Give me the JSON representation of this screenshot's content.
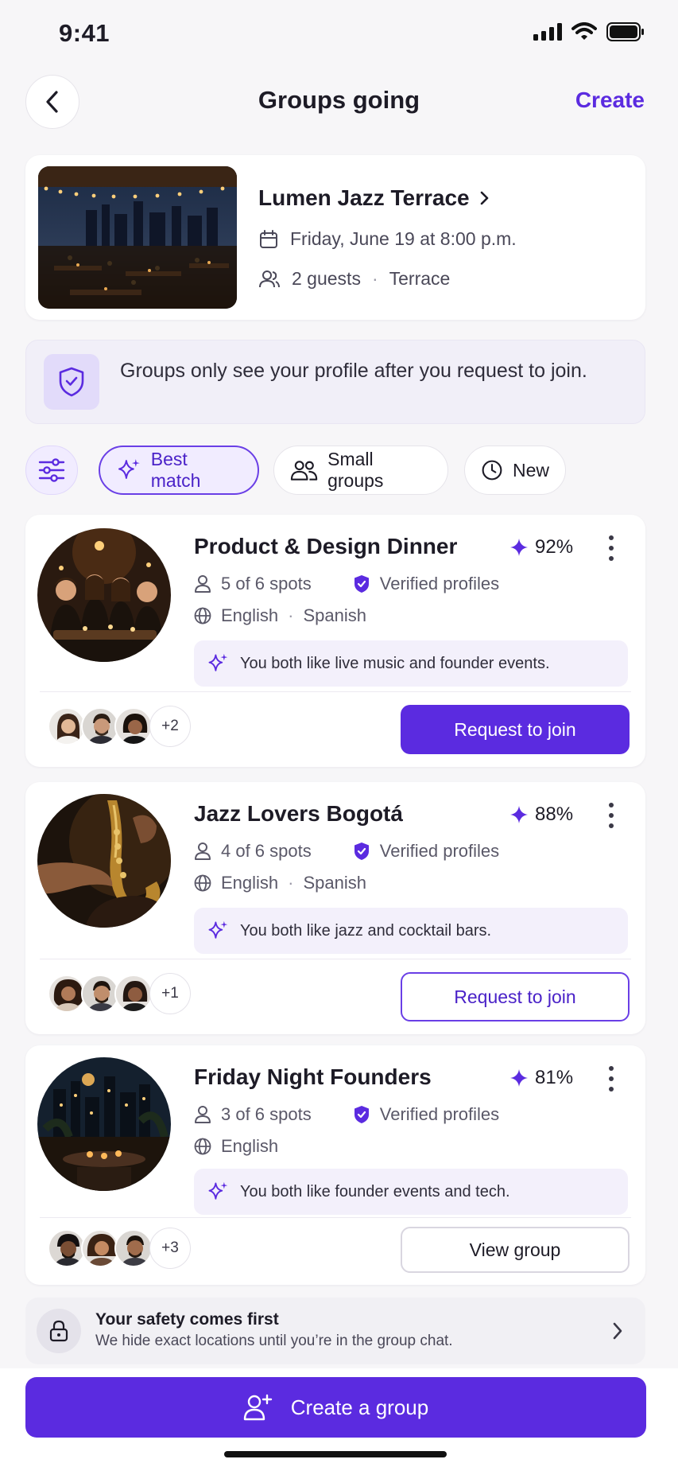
{
  "status_bar": {
    "time": "9:41"
  },
  "nav": {
    "title": "Groups going",
    "create_label": "Create"
  },
  "venue": {
    "name": "Lumen Jazz Terrace",
    "datetime": "Friday, June 19 at 8:00 p.m.",
    "guests": "2 guests",
    "separator": "·",
    "area": "Terrace"
  },
  "notice": {
    "text": "Groups only see your profile after you request to join."
  },
  "filters": {
    "best_match": "Best match",
    "small_groups": "Small groups",
    "new": "New"
  },
  "groups": [
    {
      "title": "Product & Design Dinner",
      "score": "92%",
      "spots": "5 of 6 spots",
      "verified": "Verified profiles",
      "lang1": "English",
      "sep": "·",
      "lang2": "Spanish",
      "reason": "You both like live music and founder events.",
      "more_members": "+2",
      "action": "Request to join"
    },
    {
      "title": "Jazz Lovers Bogotá",
      "score": "88%",
      "spots": "4 of 6 spots",
      "verified": "Verified profiles",
      "lang1": "English",
      "sep": "·",
      "lang2": "Spanish",
      "reason": "You both like jazz and cocktail bars.",
      "more_members": "+1",
      "action": "Request to join"
    },
    {
      "title": "Friday Night Founders",
      "score": "81%",
      "spots": "3 of 6 spots",
      "verified": "Verified profiles",
      "lang1": "English",
      "reason": "You both like founder events and tech.",
      "more_members": "+3",
      "action": "View group"
    }
  ],
  "safety": {
    "title": "Your safety comes first",
    "subtitle": "We hide exact locations until you’re in the group chat."
  },
  "cta": {
    "label": "Create a group"
  },
  "colors": {
    "accent": "#5b2be0",
    "accent_soft": "#f1ecff",
    "background": "#f7f6f8"
  },
  "icons": [
    "back-chevron-icon",
    "calendar-icon",
    "people-icon",
    "shield-check-icon",
    "sliders-icon",
    "sparkle-icon",
    "group-icon",
    "clock-icon",
    "star-icon",
    "more-icon",
    "user-icon",
    "verified-icon",
    "globe-icon",
    "lock-icon",
    "chevron-right-icon",
    "add-user-icon"
  ]
}
